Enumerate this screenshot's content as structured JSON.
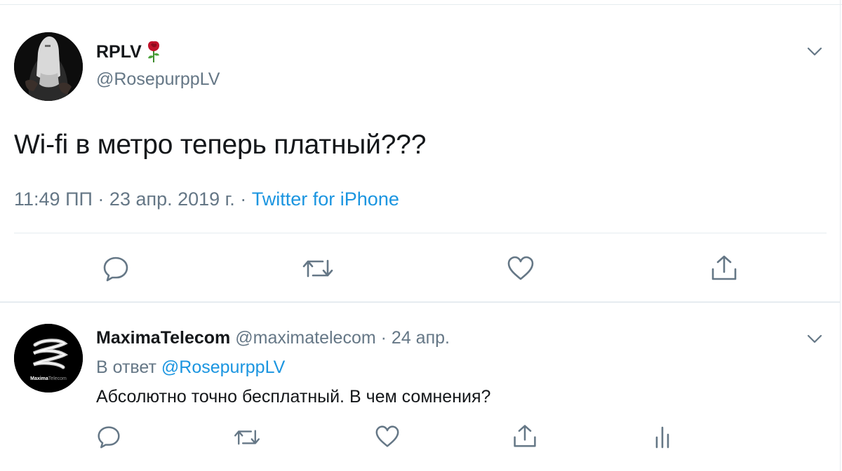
{
  "main_tweet": {
    "author_name": "RPLV",
    "author_emoji": "rose-icon",
    "author_handle": "@RosepurppLV",
    "text": "Wi-fi в метро теперь платный???",
    "time": "11:49 ПП",
    "separator": "·",
    "date": "23 апр. 2019 г.",
    "source": "Twitter for iPhone",
    "actions": [
      "reply-icon",
      "retweet-icon",
      "like-icon",
      "share-icon"
    ]
  },
  "reply_tweet": {
    "author_name": "MaximaTelecom",
    "author_handle": "@maximatelecom",
    "separator": "·",
    "date": "24 апр.",
    "reply_to_prefix": "В ответ",
    "reply_to_handle": "@RosepurppLV",
    "text": "Абсолютно точно бесплатный. В чем сомнения?",
    "avatar_logo_text_bold": "Maxima",
    "avatar_logo_text_light": "Telecom",
    "actions": [
      "reply-icon",
      "retweet-icon",
      "like-icon",
      "share-icon",
      "analytics-icon"
    ]
  },
  "colors": {
    "text_primary": "#14171a",
    "text_secondary": "#657786",
    "link": "#1b95e0",
    "divider": "#e6ecf0"
  }
}
